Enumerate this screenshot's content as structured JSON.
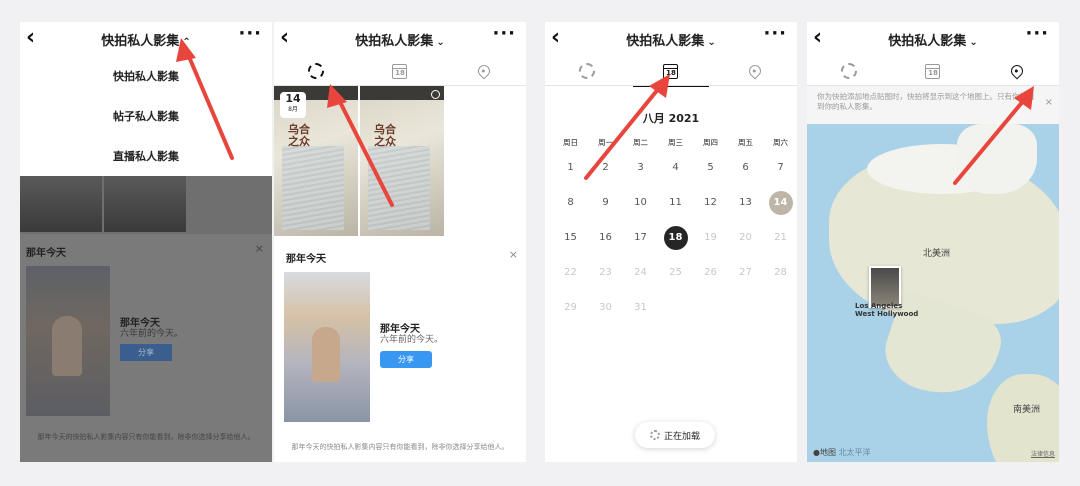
{
  "accent": "#e8453c",
  "album_title": "快拍私人影集",
  "panel1": {
    "menu_items": [
      "快拍私人影集",
      "帖子私人影集",
      "直播私人影集"
    ],
    "card_heading": "那年今天",
    "card_title": "那年今天",
    "card_sub": "六年前的今天。",
    "share_label": "分享",
    "footer": "那年今天的快拍私人影集内容只有你能看到，除非你选择分享给他人。"
  },
  "panel2": {
    "badge_day": "14",
    "badge_month": "8月",
    "book_title_1": "乌合",
    "book_title_2": "之众",
    "card_heading": "那年今天",
    "card_title": "那年今天",
    "card_sub": "六年前的今天。",
    "share_label": "分享",
    "footer": "那年今天的快拍私人影集内容只有你能看到，除非你选择分享给他人。"
  },
  "panel3": {
    "month": "八月 2021",
    "weekdays": [
      "周日",
      "周一",
      "周二",
      "周三",
      "周四",
      "周五",
      "周六"
    ],
    "weeks": [
      [
        "1",
        "2",
        "3",
        "4",
        "5",
        "6",
        "7"
      ],
      [
        "8",
        "9",
        "10",
        "11",
        "12",
        "13",
        "14"
      ],
      [
        "15",
        "16",
        "17",
        "18",
        "19",
        "20",
        "21"
      ],
      [
        "22",
        "23",
        "24",
        "25",
        "26",
        "27",
        "28"
      ],
      [
        "29",
        "30",
        "31",
        "",
        "",
        "",
        ""
      ]
    ],
    "today": "18",
    "has_content_day": "14",
    "loading_text": "正在加载"
  },
  "panel4": {
    "notice": "你为快拍添加地点贴图时，快拍将显示到这个地图上。只有你能看到你的私人影集。",
    "label_na": "北美洲",
    "label_sa": "南美洲",
    "label_pacific": "北太平洋",
    "place_1": "Los Angeles",
    "place_2": "West Hollywood",
    "attribution": "地图",
    "legal": "法律信息"
  }
}
